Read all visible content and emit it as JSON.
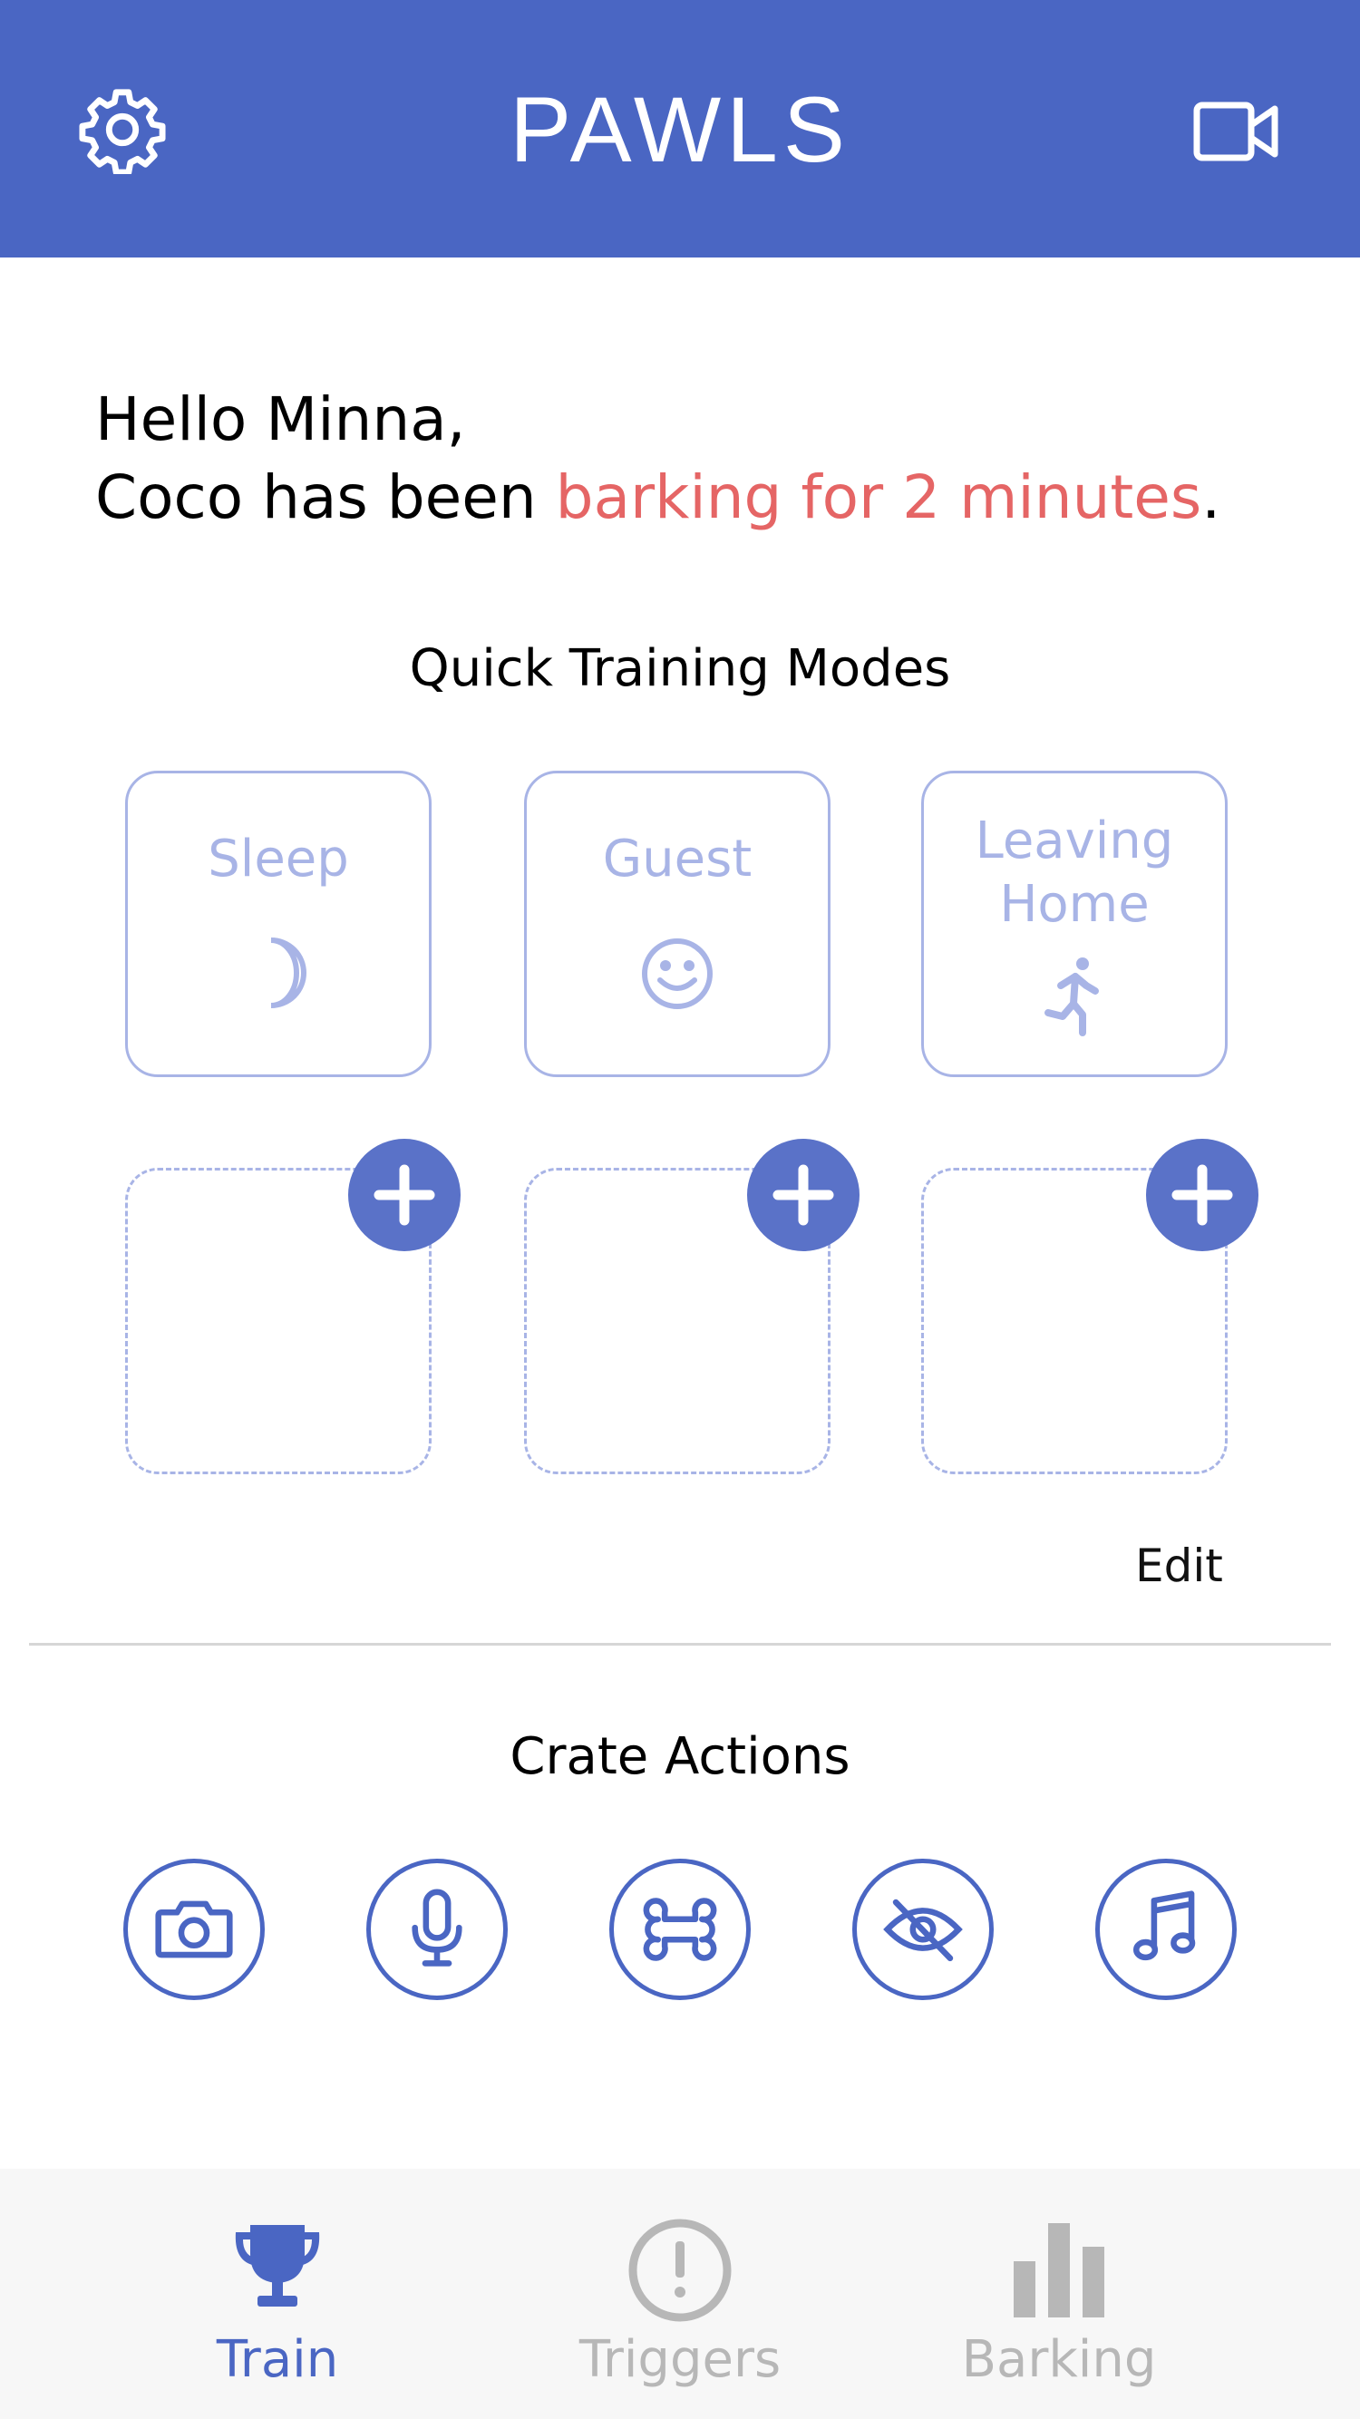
{
  "app": {
    "title": "PAWLS"
  },
  "greeting": {
    "line1": "Hello Minna,",
    "line2_prefix": "Coco has been ",
    "line2_highlight": "barking for 2 minutes",
    "line2_suffix": "."
  },
  "quick_training": {
    "title": "Quick Training Modes",
    "modes": [
      {
        "label": "Sleep",
        "icon": "moon-icon"
      },
      {
        "label": "Guest",
        "icon": "smiley-icon"
      },
      {
        "label_line1": "Leaving",
        "label_line2": "Home",
        "icon": "running-person-icon"
      }
    ],
    "empty_slots": 3,
    "edit_label": "Edit"
  },
  "crate_actions": {
    "title": "Crate Actions",
    "actions": [
      "camera-icon",
      "microphone-icon",
      "bone-icon",
      "eye-off-icon",
      "music-note-icon"
    ]
  },
  "tabs": [
    {
      "label": "Train",
      "icon": "trophy-icon",
      "active": true
    },
    {
      "label": "Triggers",
      "icon": "exclamation-circle-icon",
      "active": false
    },
    {
      "label": "Barking",
      "icon": "bar-chart-icon",
      "active": false
    }
  ],
  "colors": {
    "primary": "#4a66c3",
    "accent_text": "#e56565",
    "card_border": "#a8b4e6",
    "tab_inactive": "#b7b7b7",
    "tabbar_bg": "#f7f7f7"
  }
}
